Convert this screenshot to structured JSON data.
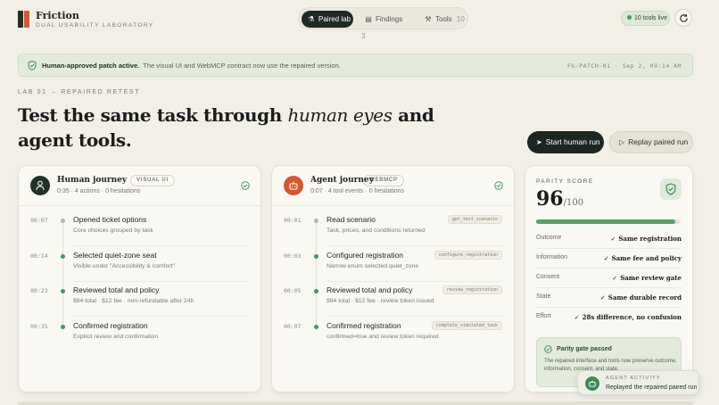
{
  "app": {
    "title": "Friction",
    "subtitle": "DUAL USABILITY LABORATORY"
  },
  "nav": {
    "tabs": [
      {
        "label": "Paired lab",
        "icon": "flask-icon",
        "count": ""
      },
      {
        "label": "Findings",
        "icon": "document-icon",
        "count": "3"
      },
      {
        "label": "Tools",
        "icon": "wrench-icon",
        "count": "10"
      }
    ]
  },
  "status": {
    "live_label": "10 tools live"
  },
  "banner": {
    "title": "Human-approved patch active.",
    "text": "The visual UI and WebMCP contract now use the repaired version.",
    "meta": "FG-PATCH-01 · Sep 2, 09:14 AM"
  },
  "hero": {
    "breadcrumb": "LAB 01  →  REPAIRED RETEST",
    "headline_start": "Test the same task through ",
    "headline_emphasis": "human eyes",
    "headline_end": " and agent tools.",
    "start_label": "Start human run",
    "replay_label": "Replay paired run"
  },
  "human": {
    "title": "Human journey",
    "badge": "VISUAL UI",
    "meta": "0:35 · 4 actions · 0 hesitations",
    "steps": [
      {
        "time": "00:07",
        "label": "Opened ticket options",
        "sub": "Core choices grouped by task",
        "state": "grey"
      },
      {
        "time": "00:14",
        "label": "Selected quiet-zone seat",
        "sub": "Visible under \"Accessibility & comfort\"",
        "state": "green"
      },
      {
        "time": "00:23",
        "label": "Reviewed total and policy",
        "sub": "$94 total · $12 fee · non-refundable after 24h",
        "state": "green"
      },
      {
        "time": "00:35",
        "label": "Confirmed registration",
        "sub": "Explicit review and confirmation",
        "state": "green"
      }
    ]
  },
  "agent": {
    "title": "Agent journey",
    "badge": "WEBMCP",
    "meta": "0:07 · 4 tool events · 0 hesitations",
    "steps": [
      {
        "time": "00:01",
        "label": "Read scenario",
        "sub": "Task, prices, and conditions returned",
        "tool": "get_test_scenario",
        "state": "grey"
      },
      {
        "time": "00:03",
        "label": "Configured registration",
        "sub": "Narrow enum selected quiet_zone",
        "tool": "configure_registration",
        "state": "green"
      },
      {
        "time": "00:05",
        "label": "Reviewed total and policy",
        "sub": "$94 total · $12 fee · review token issued",
        "tool": "review_registration",
        "state": "green"
      },
      {
        "time": "00:07",
        "label": "Confirmed registration",
        "sub": "confirmed=true and review token required",
        "tool": "complete_simulated_task",
        "state": "green"
      }
    ]
  },
  "parity": {
    "label": "PARITY SCORE",
    "score": "96",
    "out_of": "/100",
    "progress": 0.96,
    "rows": [
      {
        "key": "Outcome",
        "value": "Same registration"
      },
      {
        "key": "Information",
        "value": "Same fee and policy"
      },
      {
        "key": "Consent",
        "value": "Same review gate"
      },
      {
        "key": "State",
        "value": "Same durable record"
      },
      {
        "key": "Effort",
        "value": "28s difference, no confusion"
      }
    ],
    "gate_title": "Parity gate passed",
    "gate_text": "The repaired interface and tools now preserve outcome, information, consent, and state."
  },
  "toast": {
    "label": "AGENT ACTIVITY",
    "text": "Replayed the repaired paired run"
  },
  "colors": {
    "accent_dark": "#1f2a24",
    "accent_orange": "#d8562f",
    "success_green": "#3d9a5d",
    "background": "#f2efe7"
  }
}
